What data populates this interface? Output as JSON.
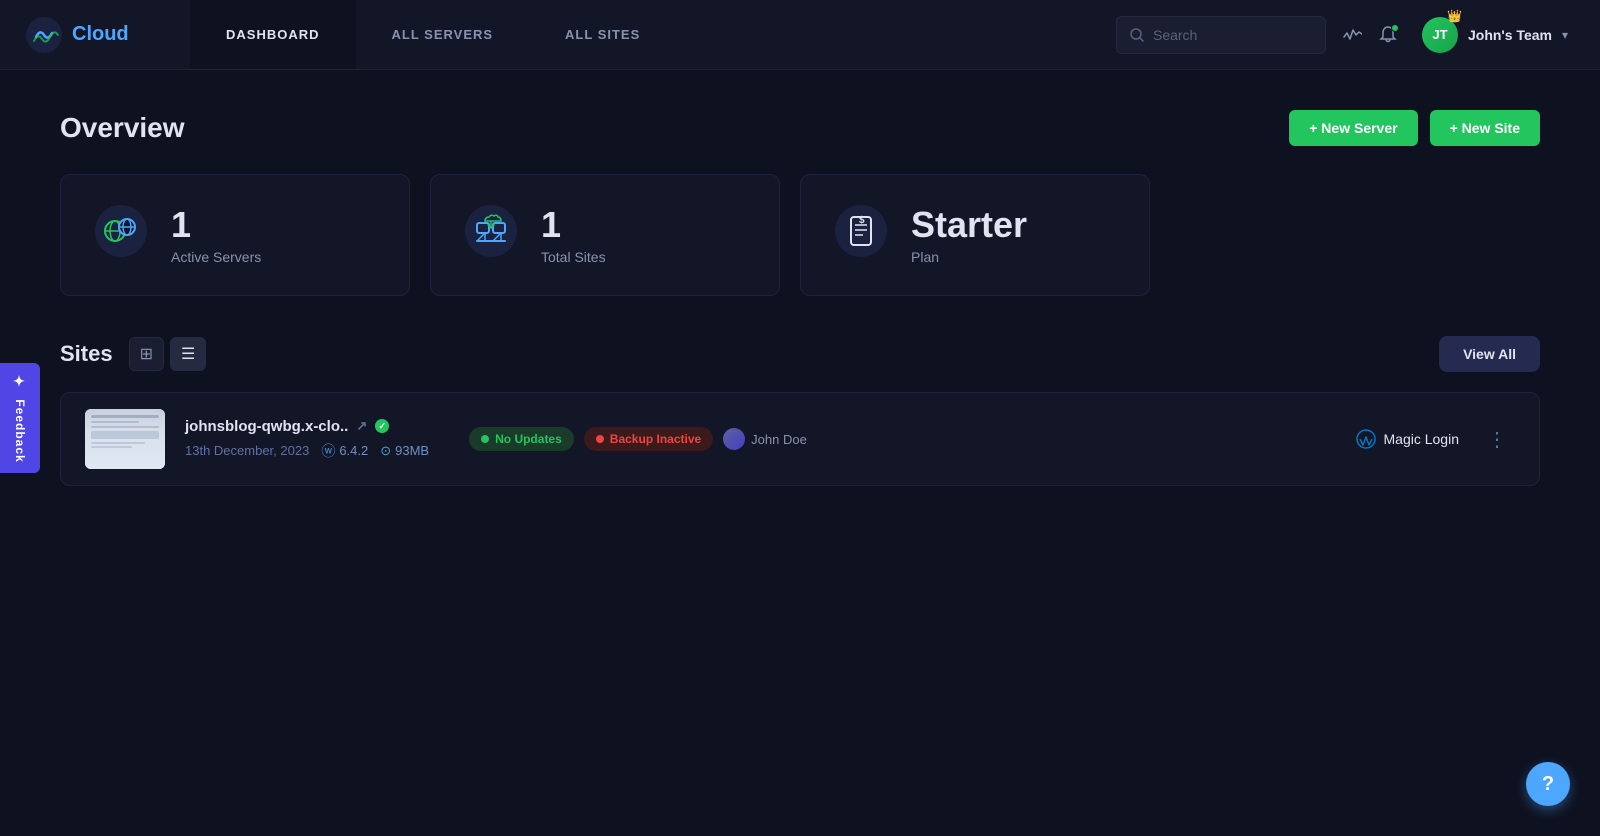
{
  "nav": {
    "logo_text": "Cloud",
    "links": [
      {
        "label": "DASHBOARD",
        "active": true
      },
      {
        "label": "ALL SERVERS",
        "active": false
      },
      {
        "label": "ALL SITES",
        "active": false
      }
    ],
    "search_placeholder": "Search",
    "team_name": "John's Team",
    "team_initials": "JT"
  },
  "overview": {
    "title": "Overview",
    "new_server_label": "+ New Server",
    "new_site_label": "+ New Site"
  },
  "stats": [
    {
      "number": "1",
      "label": "Active Servers",
      "icon": "🌐"
    },
    {
      "number": "1",
      "label": "Total Sites",
      "icon": "🖥"
    },
    {
      "label": "Plan",
      "plan_name": "Starter",
      "icon": "💲"
    }
  ],
  "sites": {
    "title": "Sites",
    "view_all_label": "View All",
    "toggle_grid_icon": "⊞",
    "toggle_list_icon": "≡",
    "items": [
      {
        "name": "johnsblog-qwbg.x-clo..",
        "date": "13th December, 2023",
        "wp_version": "6.4.2",
        "db_size": "93MB",
        "status": "active",
        "badges": [
          {
            "label": "No Updates",
            "type": "green"
          },
          {
            "label": "Backup Inactive",
            "type": "red"
          }
        ],
        "user": "John Doe",
        "magic_login_label": "Magic Login",
        "more_options": "⋮"
      }
    ]
  },
  "feedback": {
    "label": "Feedback",
    "arrow": "+"
  },
  "help": {
    "label": "?"
  }
}
